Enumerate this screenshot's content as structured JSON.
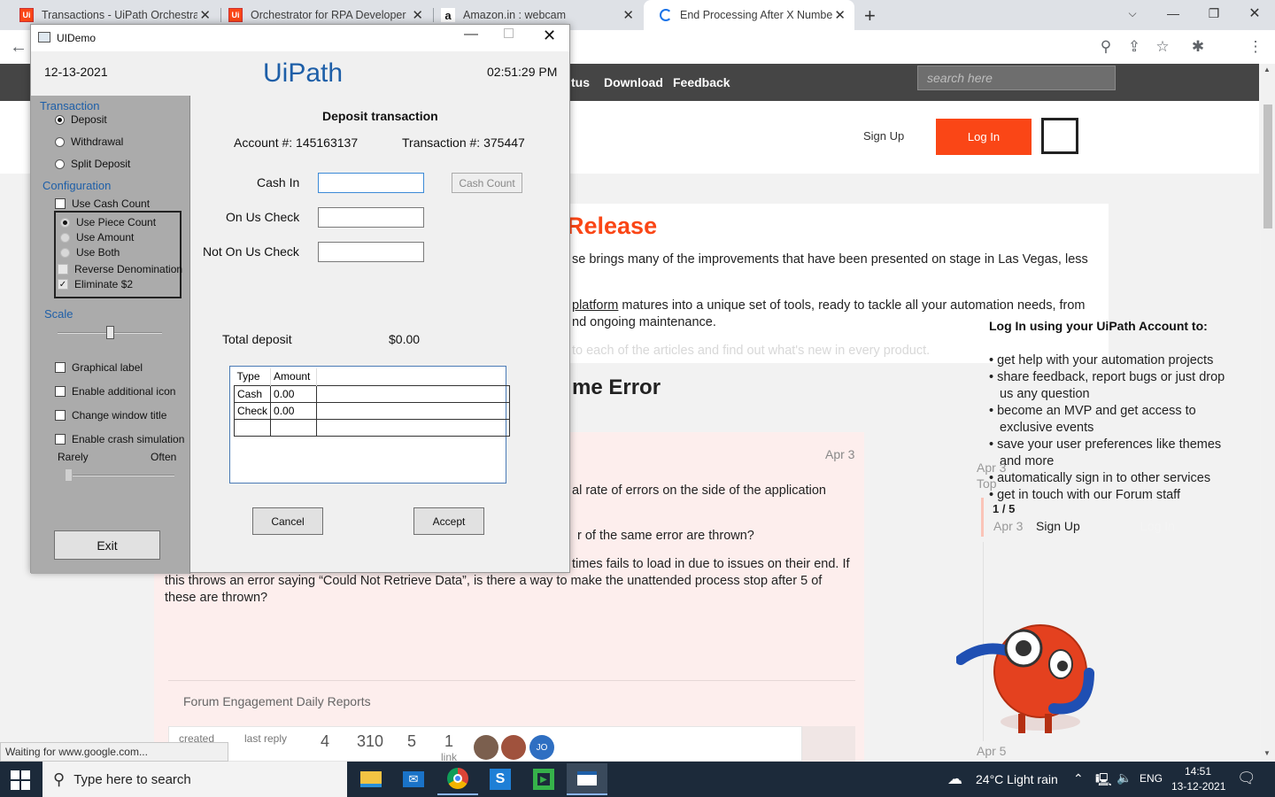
{
  "browser": {
    "tabs": [
      {
        "label": "Transactions - UiPath Orchestrato",
        "favicon": "Ui"
      },
      {
        "label": "Orchestrator for RPA Developers",
        "favicon": "Ui"
      },
      {
        "label": "Amazon.in : webcam",
        "favicon": "a"
      },
      {
        "label": "End Processing After X Number o",
        "favicon": "loading"
      }
    ],
    "new_tab": "+",
    "status": "Waiting for www.google.com..."
  },
  "site": {
    "nav": [
      "tus",
      "Download",
      "Feedback"
    ],
    "search_placeholder": "search here",
    "sign_up": "Sign Up",
    "log_in": "Log In",
    "release_title": "Release",
    "release_p1": "se brings many of the improvements that have been presented on stage in Las Vegas, less",
    "release_link": "platform",
    "release_p2a": " matures into a unique set of tools, ready to tackle all your automation needs, from",
    "release_p2b": "nd ongoing maintenance.",
    "release_p3": " to each of the articles and find out what's new in every product.",
    "error_title": "me Error",
    "post_date": "Apr 3",
    "post_l1": "al rate of errors on the side of the application",
    "post_l2": "r of the same error are thrown?",
    "post_l3": "times fails to load in due to issues on their end. If",
    "post_l4": "this throws an error saying “Could Not Retrieve Data”, is there a way to make the unattended process stop after 5 of",
    "post_l5": "these are thrown?",
    "engagement": "Forum Engagement Daily Reports",
    "stats": {
      "created": "created",
      "last_reply": "last reply",
      "replies": "4",
      "views": "310",
      "users": "5",
      "links": "1",
      "link_label": "link"
    },
    "avatar_jo": "JO",
    "login_prompt_title": "Log In using your UiPath Account to:",
    "login_bullets": [
      "get help with your automation projects",
      "share feedback, report bugs or just drop us any question",
      "become an MVP and get access to exclusive events",
      "save your user preferences like themes and more",
      "automatically sign in to other services",
      "get in touch with our Forum staff"
    ],
    "timeline": {
      "date1": "Apr 3",
      "top": "Top",
      "page": "1 / 5",
      "date2": "Apr 3",
      "sign_up": "Sign Up",
      "log_in": "Log In",
      "date3": "Apr 5"
    }
  },
  "demo": {
    "window_title": "UIDemo",
    "date": "12-13-2021",
    "brand": "UiPath",
    "time": "02:51:29 PM",
    "transaction_head": "Transaction",
    "transaction_options": [
      "Deposit",
      "Withdrawal",
      "Split Deposit"
    ],
    "config_head": "Configuration",
    "use_cash_count": "Use Cash Count",
    "count_options": [
      "Use Piece Count",
      "Use Amount",
      "Use Both"
    ],
    "reverse_denom": "Reverse Denomination",
    "eliminate": "Eliminate $2",
    "scale_head": "Scale",
    "options": [
      "Graphical label",
      "Enable additional icon",
      "Change window title",
      "Enable crash simulation"
    ],
    "rarely": "Rarely",
    "often": "Often",
    "exit": "Exit",
    "form_title": "Deposit transaction",
    "account": "Account #:  145163137",
    "transaction": "Transaction #:  375447",
    "cash_in": "Cash In",
    "cash_count_btn": "Cash Count",
    "on_us": "On Us Check",
    "not_on_us": "Not On Us Check",
    "total_label": "Total deposit",
    "total_value": "$0.00",
    "grid": {
      "headers": [
        "Type",
        "Amount"
      ],
      "rows": [
        [
          "Cash",
          "0.00"
        ],
        [
          "Check",
          "0.00"
        ]
      ]
    },
    "cancel": "Cancel",
    "accept": "Accept"
  },
  "taskbar": {
    "search": "Type here to search",
    "weather": "24°C  Light rain",
    "lang": "ENG",
    "time": "14:51",
    "date": "13-12-2021"
  },
  "colors": {
    "accent": "#fa4616",
    "brand_blue": "#1e5fa8",
    "taskbar": "#1c2a3a"
  }
}
